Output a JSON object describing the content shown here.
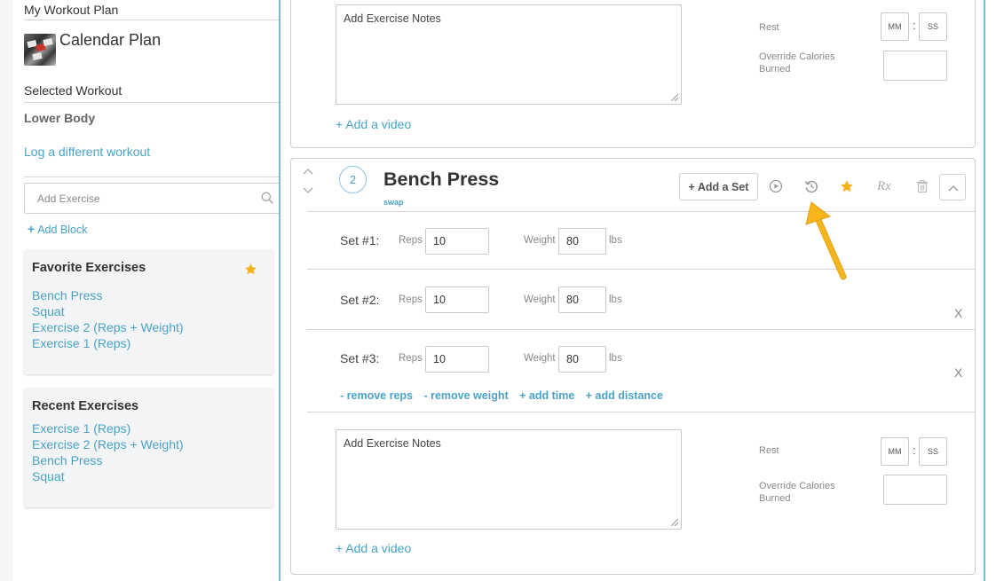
{
  "sidebar": {
    "plan_section_title": "My Workout Plan",
    "plan_name": "Calendar Plan",
    "selected_section_title": "Selected Workout",
    "workout_name": "Lower Body",
    "log_link": "Log a different workout",
    "search_placeholder": "Add Exercise",
    "add_block": "Add Block",
    "add_block_plus": "+",
    "favorites": {
      "title": "Favorite Exercises",
      "items": [
        "Bench Press",
        "Squat",
        "Exercise 2 (Reps + Weight)",
        "Exercise 1 (Reps)"
      ]
    },
    "recent": {
      "title": "Recent Exercises",
      "items": [
        "Exercise 1 (Reps)",
        "Exercise 2 (Reps + Weight)",
        "Bench Press",
        "Squat"
      ]
    }
  },
  "previous_exercise": {
    "notes_placeholder": "Add Exercise Notes",
    "add_video": "+ Add a video",
    "rest_label": "Rest",
    "minutes_placeholder": "MM",
    "seconds_placeholder": "SS",
    "colon": ":",
    "calories_label_line1": "Override Calories",
    "calories_label_line2": "Burned"
  },
  "exercise": {
    "number": "2",
    "name": "Bench Press",
    "swap": "swap",
    "add_set": "+ Add a Set",
    "rx": "Rx",
    "sets": [
      {
        "label": "Set #1:",
        "reps_label": "Reps",
        "reps": "10",
        "weight_label": "Weight",
        "weight": "80",
        "unit": "lbs",
        "remove": ""
      },
      {
        "label": "Set #2:",
        "reps_label": "Reps",
        "reps": "10",
        "weight_label": "Weight",
        "weight": "80",
        "unit": "lbs",
        "remove": "X"
      },
      {
        "label": "Set #3:",
        "reps_label": "Reps",
        "reps": "10",
        "weight_label": "Weight",
        "weight": "80",
        "unit": "lbs",
        "remove": "X"
      }
    ],
    "set_links": [
      "- remove reps",
      "- remove weight",
      "+ add time",
      "+ add distance"
    ],
    "notes_placeholder": "Add Exercise Notes",
    "add_video": "+ Add a video",
    "rest_label": "Rest",
    "minutes_placeholder": "MM",
    "seconds_placeholder": "SS",
    "colon": ":",
    "calories_label_line1": "Override Calories",
    "calories_label_line2": "Burned"
  },
  "colors": {
    "link": "#4aa3c7",
    "border_accent": "#74b9d9",
    "star": "#f5b31b",
    "arrow": "#f7b51c"
  },
  "icons": {
    "search": "search-icon",
    "favorite_star": "star-icon",
    "play": "play-icon",
    "history": "history-icon",
    "trash": "trash-icon",
    "collapse": "chevron-up-icon",
    "move_up": "chevron-up-icon",
    "move_down": "chevron-down-icon"
  }
}
